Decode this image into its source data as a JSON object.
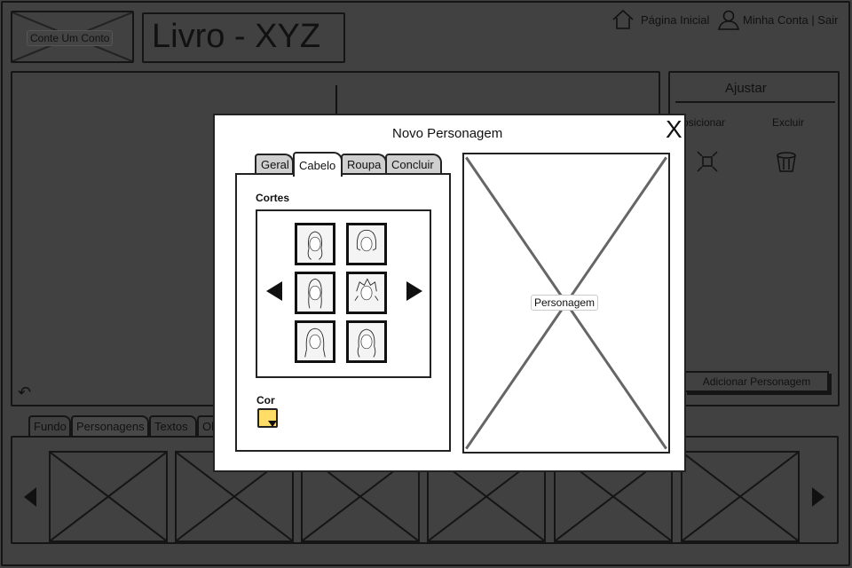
{
  "header": {
    "logo_label": "Conte Um Conto",
    "book_title": "Livro - XYZ",
    "home_link": "Página Inicial",
    "account_link": "Minha Conta | Sair"
  },
  "adjust_panel": {
    "title": "Ajustar",
    "position_label": "Posicionar",
    "delete_label": "Excluir",
    "add_character_button": "Adicionar Personagem"
  },
  "bottom_tabs": [
    {
      "label": "Fundo"
    },
    {
      "label": "Personagens"
    },
    {
      "label": "Textos"
    },
    {
      "label": "Objetos"
    }
  ],
  "modal": {
    "title": "Novo Personagem",
    "tabs": [
      {
        "label": "Geral"
      },
      {
        "label": "Cabelo"
      },
      {
        "label": "Roupa"
      },
      {
        "label": "Concluir"
      }
    ],
    "active_tab": "Cabelo",
    "cuts_label": "Cortes",
    "color_label": "Cor",
    "color_value": "#ffdd66",
    "preview_label": "Personagem"
  },
  "colors": {
    "overlay_bg": "#414141",
    "swatch": "#ffdd66"
  }
}
